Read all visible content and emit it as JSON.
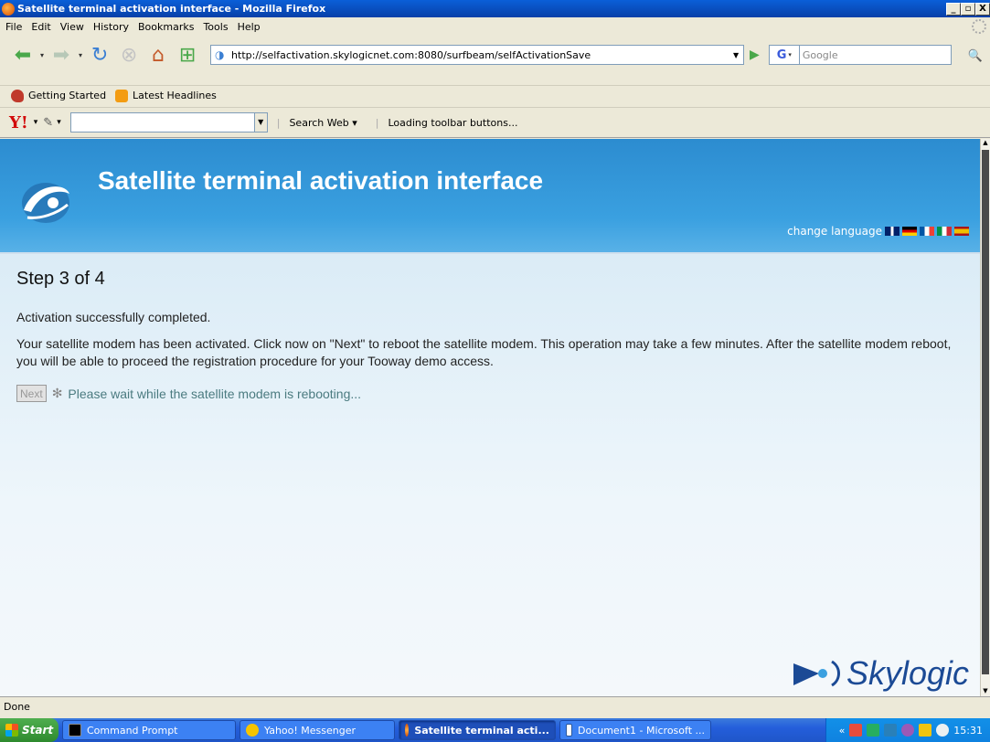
{
  "window": {
    "title": "Satellite terminal activation interface - Mozilla Firefox",
    "buttons": [
      "_",
      "ɑ",
      "X"
    ]
  },
  "menu": [
    "File",
    "Edit",
    "View",
    "History",
    "Bookmarks",
    "Tools",
    "Help"
  ],
  "navbar": {
    "url": "http://selfactivation.skylogicnet.com:8080/surfbeam/selfActivationSave",
    "search_engine": "G",
    "search_placeholder": "Google"
  },
  "bookmarks": [
    {
      "label": "Getting Started",
      "icon": "getting-started-icon"
    },
    {
      "label": "Latest Headlines",
      "icon": "rss-icon"
    }
  ],
  "yahoo_toolbar": {
    "logo": "Y!",
    "search_web": "Search Web",
    "loading": "Loading toolbar buttons..."
  },
  "page": {
    "site_title": "Satellite terminal activation interface",
    "change_language": "change language",
    "step": "Step 3 of 4",
    "status": "Activation successfully completed.",
    "description": "Your satellite modem has been activated. Click now on \"Next\" to reboot the satellite modem. This operation may take a few minutes. After the satellite modem reboot, you will be able to proceed the registration procedure for your Tooway demo access.",
    "next_label": "Next",
    "wait_message": "Please wait while the satellite modem is rebooting...",
    "brand": "Skylogic"
  },
  "statusbar": {
    "text": "Done"
  },
  "taskbar": {
    "start": "Start",
    "tasks": [
      {
        "label": "Command Prompt"
      },
      {
        "label": "Yahoo! Messenger"
      },
      {
        "label": "Satellite terminal acti..."
      },
      {
        "label": "Document1 - Microsoft ..."
      }
    ],
    "clock": "15:31"
  }
}
